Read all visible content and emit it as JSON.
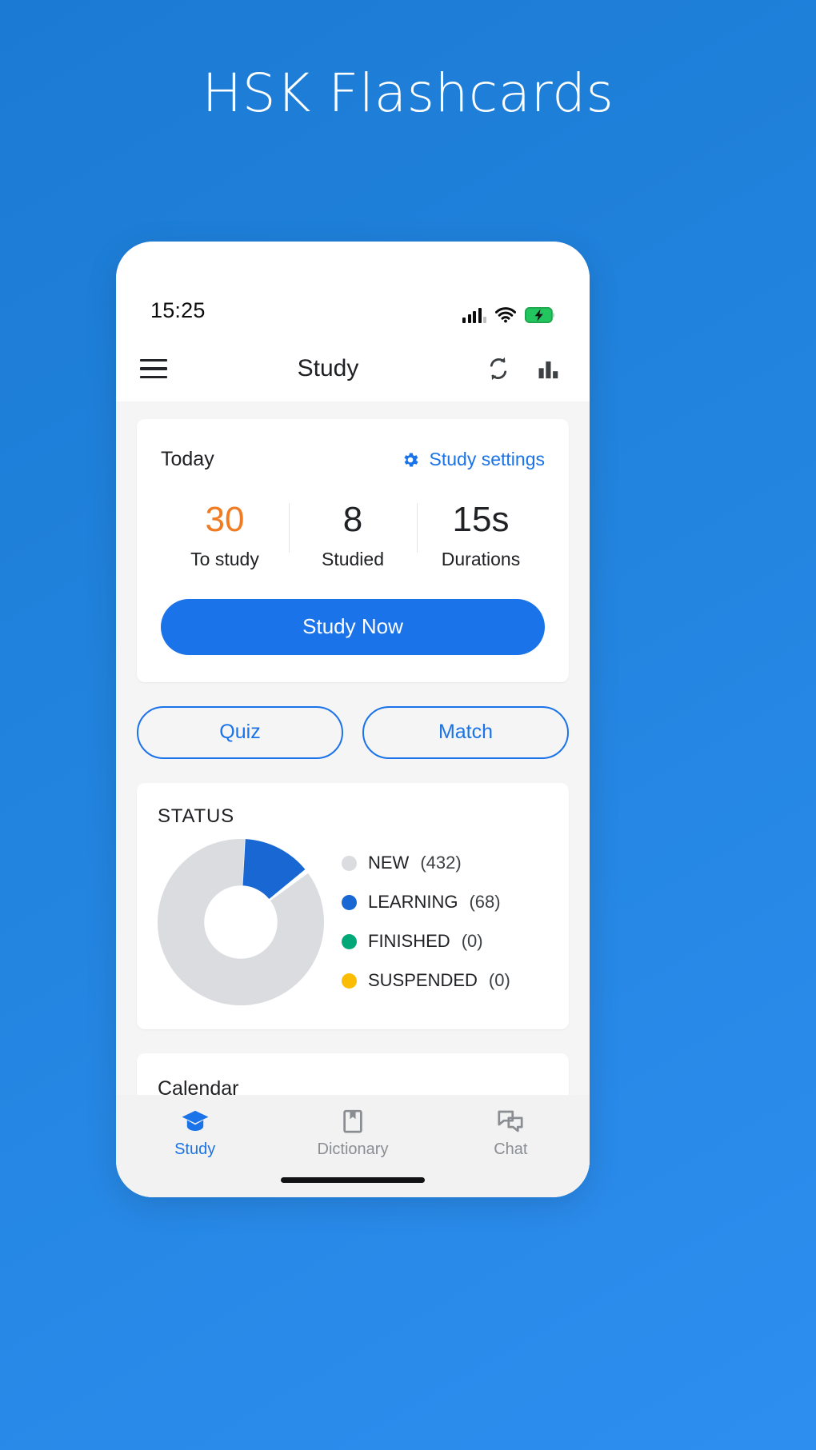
{
  "banner": {
    "title": "HSK Flashcards",
    "background_color": "#2183dd"
  },
  "status_bar": {
    "time": "15:25",
    "signal_icon": "cellular-signal-icon",
    "wifi_icon": "wifi-icon",
    "battery_icon": "battery-charging-icon",
    "battery_color": "#22c55e"
  },
  "app_bar": {
    "menu_icon": "hamburger-menu-icon",
    "title": "Study",
    "sync_icon": "sync-icon",
    "stats_icon": "bar-chart-icon"
  },
  "today_card": {
    "label": "Today",
    "settings_label": "Study settings",
    "settings_icon": "gear-icon",
    "accent_color": "#f07b23",
    "stats": [
      {
        "value": "30",
        "label": "To study",
        "accent": true
      },
      {
        "value": "8",
        "label": "Studied",
        "accent": false
      },
      {
        "value": "15s",
        "label": "Durations",
        "accent": false
      }
    ],
    "primary_button": "Study Now",
    "primary_button_color": "#1a73e8"
  },
  "action_buttons": [
    {
      "label": "Quiz"
    },
    {
      "label": "Match"
    }
  ],
  "status_section": {
    "title": "STATUS",
    "legend": [
      {
        "label": "NEW",
        "count": "(432)",
        "color": "#dadce0"
      },
      {
        "label": "LEARNING",
        "count": "(68)",
        "color": "#1967d2"
      },
      {
        "label": "FINISHED",
        "count": "(0)",
        "color": "#00a878"
      },
      {
        "label": "SUSPENDED",
        "count": "(0)",
        "color": "#fbbc04"
      }
    ]
  },
  "chart_data": {
    "type": "pie",
    "title": "STATUS",
    "labels": [
      "NEW",
      "LEARNING",
      "FINISHED",
      "SUSPENDED"
    ],
    "values": [
      432,
      68,
      0,
      0
    ],
    "colors": [
      "#dadce0",
      "#1967d2",
      "#00a878",
      "#fbbc04"
    ],
    "total": 500,
    "donut": true,
    "inner_radius_ratio": 0.55,
    "start_angle_deg": 0,
    "legend_position": "right"
  },
  "calendar_card": {
    "title": "Calendar"
  },
  "bottom_nav": {
    "active_color": "#1a73e8",
    "inactive_color": "#8a8d91",
    "items": [
      {
        "label": "Study",
        "icon": "graduation-cap-icon",
        "active": true
      },
      {
        "label": "Dictionary",
        "icon": "book-bookmark-icon",
        "active": false
      },
      {
        "label": "Chat",
        "icon": "chat-bubbles-icon",
        "active": false
      }
    ]
  }
}
